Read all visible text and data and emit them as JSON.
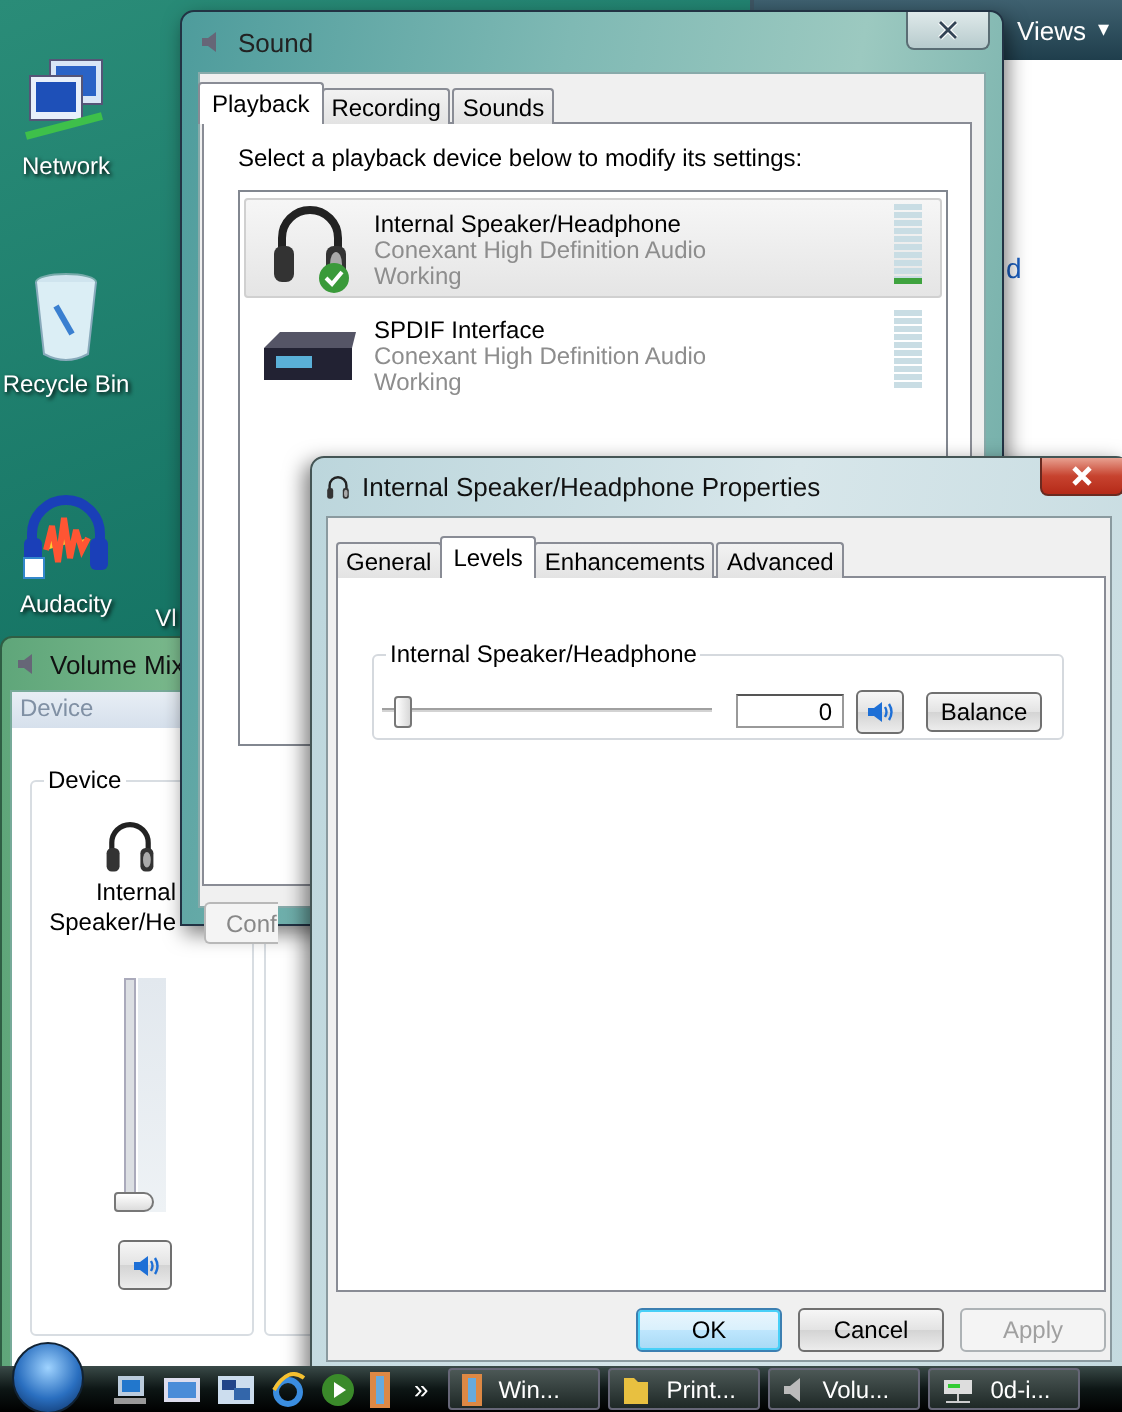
{
  "desktop_icons": [
    {
      "label": "Network",
      "kind": "network"
    },
    {
      "label": "Recycle Bin",
      "kind": "recycle"
    },
    {
      "label": "Audacity",
      "kind": "audacity"
    },
    {
      "label": "Vl",
      "kind": "partial"
    }
  ],
  "explorer_window": {
    "toolbar_button": "Views",
    "caret": "▾",
    "link_fragment": "d"
  },
  "volume_mixer": {
    "title": "Volume Mix",
    "menu": [
      "Device"
    ],
    "group_label": "Device",
    "device_name_lines": [
      "Internal",
      "Speaker/He"
    ],
    "level": 0,
    "muted": false
  },
  "sound_window": {
    "title": "Sound",
    "tabs": [
      {
        "label": "Playback",
        "selected": true
      },
      {
        "label": "Recording",
        "selected": false
      },
      {
        "label": "Sounds",
        "selected": false
      }
    ],
    "instruction": "Select a playback device below to modify its settings:",
    "devices": [
      {
        "kind": "headphones",
        "name": "Internal Speaker/Headphone",
        "driver": "Conexant High Definition Audio",
        "status": "Working",
        "selected": true,
        "default": true,
        "level": 0.1
      },
      {
        "kind": "spdif",
        "name": "SPDIF Interface",
        "driver": "Conexant High Definition Audio",
        "status": "Working",
        "selected": false,
        "default": false,
        "level": 0
      }
    ],
    "buttons": [
      "Conf"
    ]
  },
  "properties_window": {
    "title": "Internal Speaker/Headphone Properties",
    "tabs": [
      {
        "label": "General",
        "selected": false
      },
      {
        "label": "Levels",
        "selected": true
      },
      {
        "label": "Enhancements",
        "selected": false
      },
      {
        "label": "Advanced",
        "selected": false
      }
    ],
    "group_label": "Internal Speaker/Headphone",
    "level": 0,
    "value": "0",
    "muted": false,
    "balance_button": "Balance",
    "buttons": [
      {
        "label": "OK",
        "default": true,
        "disabled": false
      },
      {
        "label": "Cancel",
        "default": false,
        "disabled": false
      },
      {
        "label": "Apply",
        "default": false,
        "disabled": true
      }
    ]
  },
  "taskbar": {
    "more": "»",
    "tasks": [
      {
        "label": "Win...",
        "kind": "video"
      },
      {
        "label": "Print...",
        "kind": "folder"
      },
      {
        "label": "Volu...",
        "kind": "speaker"
      },
      {
        "label": "0d-i...",
        "kind": "network"
      }
    ]
  }
}
